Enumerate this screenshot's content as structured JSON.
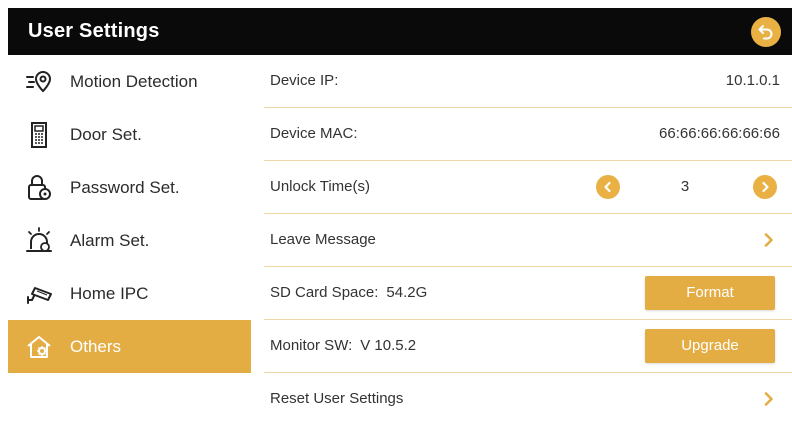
{
  "header": {
    "title": "User Settings",
    "back_icon": "back-arrow-icon"
  },
  "colors": {
    "accent": "#e4ad44",
    "header_bg": "#0a0a0a",
    "divider": "#f0d8a8"
  },
  "sidebar": {
    "items": [
      {
        "label": "Motion Detection",
        "icon": "motion-detection-icon",
        "active": false
      },
      {
        "label": "Door Set.",
        "icon": "door-panel-icon",
        "active": false
      },
      {
        "label": "Password Set.",
        "icon": "password-lock-icon",
        "active": false
      },
      {
        "label": "Alarm Set.",
        "icon": "alarm-icon",
        "active": false
      },
      {
        "label": "Home IPC",
        "icon": "ip-camera-icon",
        "active": false
      },
      {
        "label": "Others",
        "icon": "home-settings-icon",
        "active": true
      }
    ]
  },
  "settings": {
    "device_ip": {
      "label": "Device IP:",
      "value": "10.1.0.1"
    },
    "device_mac": {
      "label": "Device MAC:",
      "value": "66:66:66:66:66:66"
    },
    "unlock_time": {
      "label": "Unlock Time(s)",
      "value": "3"
    },
    "leave_message": {
      "label": "Leave Message"
    },
    "sd_card": {
      "label": "SD Card Space:",
      "value": "54.2G",
      "button": "Format"
    },
    "monitor_sw": {
      "label": "Monitor SW:",
      "value": "V 10.5.2",
      "button": "Upgrade"
    },
    "reset": {
      "label": "Reset User Settings"
    }
  }
}
